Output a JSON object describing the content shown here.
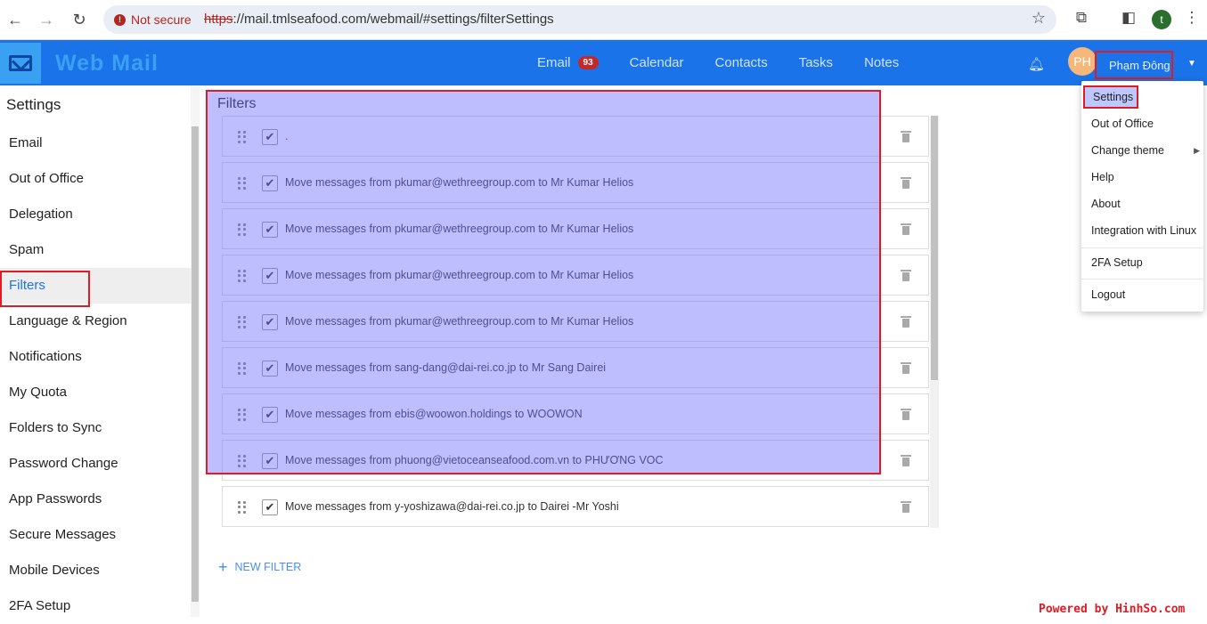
{
  "browser": {
    "security_label": "Not secure",
    "url_scheme": "https",
    "url_rest": "://mail.tmlseafood.com/webmail/#settings/filterSettings",
    "profile_initial": "t"
  },
  "header": {
    "app_title": "Web Mail",
    "nav": [
      {
        "label": "Email",
        "badge": "93"
      },
      {
        "label": "Calendar"
      },
      {
        "label": "Contacts"
      },
      {
        "label": "Tasks"
      },
      {
        "label": "Notes"
      }
    ],
    "avatar_initials": "PH",
    "user_name": "Phạm Đông Hải"
  },
  "sidebar": {
    "title": "Settings",
    "items": [
      {
        "label": "Email"
      },
      {
        "label": "Out of Office"
      },
      {
        "label": "Delegation"
      },
      {
        "label": "Spam"
      },
      {
        "label": "Filters",
        "active": true
      },
      {
        "label": "Language & Region"
      },
      {
        "label": "Notifications"
      },
      {
        "label": "My Quota"
      },
      {
        "label": "Folders to Sync"
      },
      {
        "label": "Password Change"
      },
      {
        "label": "App Passwords"
      },
      {
        "label": "Secure Messages"
      },
      {
        "label": "Mobile Devices"
      },
      {
        "label": "2FA Setup"
      }
    ]
  },
  "main": {
    "title": "Filters",
    "filters": [
      {
        "text": ".",
        "enabled": true
      },
      {
        "text": "Move messages from pkumar@wethreegroup.com to Mr Kumar Helios",
        "enabled": true
      },
      {
        "text": "Move messages from pkumar@wethreegroup.com to Mr Kumar Helios",
        "enabled": true
      },
      {
        "text": "Move messages from pkumar@wethreegroup.com to Mr Kumar Helios",
        "enabled": true
      },
      {
        "text": "Move messages from pkumar@wethreegroup.com to Mr Kumar Helios",
        "enabled": true
      },
      {
        "text": "Move messages from sang-dang@dai-rei.co.jp to Mr Sang Dairei",
        "enabled": true
      },
      {
        "text": "Move messages from ebis@woowon.holdings to WOOWON",
        "enabled": true
      },
      {
        "text": "Move messages from phuong@vietoceanseafood.com.vn to PHƯƠNG VOC",
        "enabled": true
      },
      {
        "text": "Move messages from y-yoshizawa@dai-rei.co.jp to Dairei -Mr Yoshi",
        "enabled": true
      }
    ],
    "new_filter_label": "NEW FILTER"
  },
  "user_dropdown": {
    "items": [
      {
        "label": "Settings",
        "selected": true
      },
      {
        "label": "Out of Office"
      },
      {
        "label": "Change theme",
        "submenu": true
      },
      {
        "label": "Help"
      },
      {
        "label": "About"
      },
      {
        "label": "Integration with Linux"
      },
      {
        "label": "2FA Setup"
      },
      {
        "label": "Logout"
      }
    ]
  },
  "watermark": "Powered by HinhSo.com",
  "colors": {
    "header_blue": "#1a73e8",
    "accent_red": "#e01b24",
    "overlay": "#6e6eff",
    "badge_red": "#c62828"
  }
}
